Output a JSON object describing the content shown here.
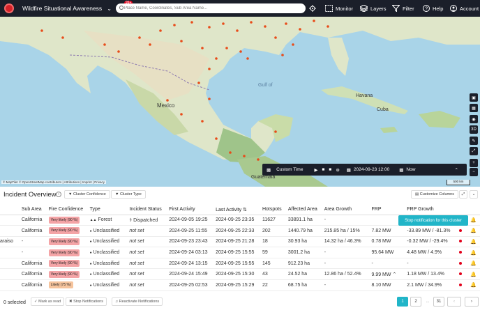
{
  "topbar": {
    "title": "Wildfire Situational Awareness",
    "notification_badge": "99+",
    "search_placeholder": "Place Name, Coordinates, Sub Area Name...",
    "monitor": "Monitor",
    "layers": "Layers",
    "filter": "Filter",
    "help": "Help",
    "account": "Account"
  },
  "map": {
    "labels": {
      "mexico": "Mexico",
      "cuba": "Cuba",
      "gulf": "Gulf of",
      "guatemala": "Guatemala",
      "havana": "Havana"
    },
    "attribution": "© MapTiler © OpenStreetMap contributors | Attributions | Imprint | Privacy",
    "scale": "500 km",
    "side_buttons": [
      "map-icon",
      "grid-icon",
      "camera-icon",
      "3D",
      "ruler-icon",
      "expand-icon",
      "+",
      "−"
    ]
  },
  "timebar": {
    "mode": "Custom Time",
    "date": "2024-09-23 12:00",
    "end": "Now"
  },
  "overview": {
    "title": "Incident Overview",
    "filters": [
      "Cluster Confidence",
      "Cluster Type"
    ],
    "customize": "Customize Columns",
    "columns": [
      "Sub Area",
      "Fire Confidence",
      "Type",
      "Incident Status",
      "First Activity",
      "Last Activity",
      "Hotspots",
      "Affected Area",
      "Area Growth",
      "FRP",
      "FRP Growth"
    ],
    "rows": [
      {
        "lead": "",
        "sub": "California",
        "conf": "Very likely (90 %)",
        "type": "Forest",
        "status": "Dispatched",
        "first": "2024-09-05 19:25",
        "last": "2024-09-25 23:35",
        "hot": "11627",
        "area": "33891.1 ha",
        "growth": "-",
        "frp": "",
        "frpg": ""
      },
      {
        "lead": "",
        "sub": "California",
        "conf": "Very likely (90 %)",
        "type": "Unclassified",
        "status": "not set",
        "first": "2024-09-25 11:55",
        "last": "2024-09-25 22:33",
        "hot": "202",
        "area": "1440.79 ha",
        "growth": "215.85 ha / 15%",
        "frp": "7.82 MW",
        "frpg": "-33.89 MW / -81.3%"
      },
      {
        "lead": "araiso",
        "sub": "-",
        "conf": "Very likely (90 %)",
        "type": "Unclassified",
        "status": "not set",
        "first": "2024-09-23 23:43",
        "last": "2024-09-25 21:28",
        "hot": "18",
        "area": "30.93 ha",
        "growth": "14.32 ha / 46.3%",
        "frp": "0.78 MW",
        "frpg": "-0.32 MW / -29.4%"
      },
      {
        "lead": "",
        "sub": "-",
        "conf": "Very likely (90 %)",
        "type": "Unclassified",
        "status": "not set",
        "first": "2024-09-24 03:13",
        "last": "2024-09-25 15:55",
        "hot": "59",
        "area": "3001.2 ha",
        "growth": "-",
        "frp": "95.64 MW",
        "frpg": "4.48 MW / 4.9%"
      },
      {
        "lead": "",
        "sub": "California",
        "conf": "Very likely (90 %)",
        "type": "Unclassified",
        "status": "not set",
        "first": "2024-09-24 13:15",
        "last": "2024-09-25 15:55",
        "hot": "145",
        "area": "912.23 ha",
        "growth": "-",
        "frp": "-",
        "frpg": "-"
      },
      {
        "lead": "",
        "sub": "California",
        "conf": "Very likely (90 %)",
        "type": "Unclassified",
        "status": "not set",
        "first": "2024-09-24 15:49",
        "last": "2024-09-25 15:30",
        "hot": "43",
        "area": "24.52 ha",
        "growth": "12.86 ha / 52.4%",
        "frp": "9.99 MW",
        "frpg": "1.18 MW / 13.4%"
      },
      {
        "lead": "",
        "sub": "California",
        "conf": "Likely (75 %)",
        "type": "Unclassified",
        "status": "not set",
        "first": "2024-09-25 02:53",
        "last": "2024-09-25 15:29",
        "hot": "22",
        "area": "68.75 ha",
        "growth": "-",
        "frp": "8.10 MW",
        "frpg": "2.1 MW / 34.9%"
      }
    ],
    "tooltip": "Stop notification for this cluster"
  },
  "footer": {
    "selected": "0 selected",
    "mark_read": "Mark as read",
    "stop": "Stop Notifications",
    "reactivate": "Reactivate Notifications",
    "pages": [
      "1",
      "2",
      "...",
      "31"
    ]
  },
  "colors": {
    "accent": "#21b5c8",
    "topbar": "#1b1f2a",
    "danger": "#e2001a"
  }
}
